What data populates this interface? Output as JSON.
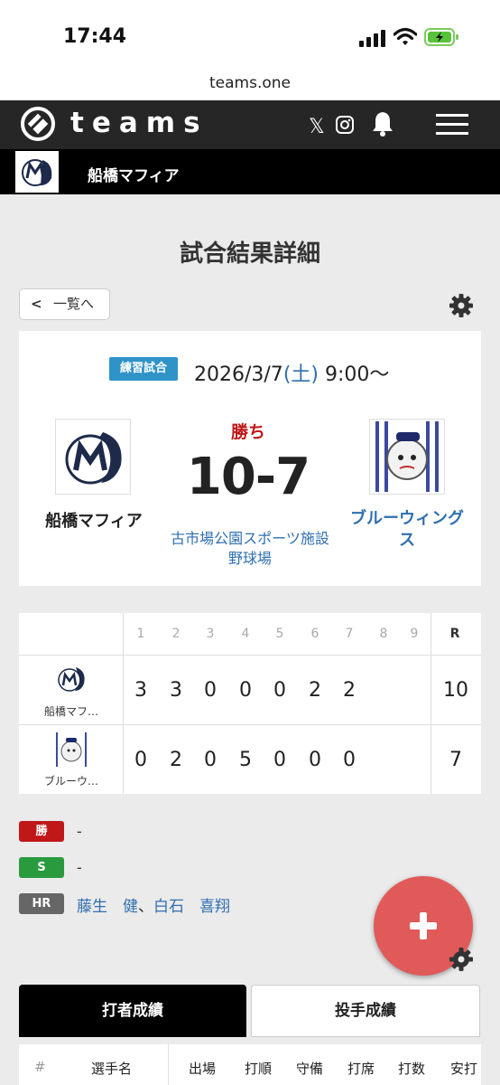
{
  "status": {
    "time": "17:44"
  },
  "browser": {
    "url": "teams.one"
  },
  "header": {
    "brand": "teams",
    "x_icon": "𝕏",
    "icons": [
      "logo-icon",
      "x-icon",
      "instagram-icon",
      "bell-icon",
      "menu-icon"
    ]
  },
  "teambar": {
    "team_name": "船橋マフィア"
  },
  "page": {
    "title": "試合結果詳細",
    "back_label": "一覧へ",
    "back_chevron": "<"
  },
  "game": {
    "type_badge": "練習試合",
    "date": "2026/3/7",
    "dow_open": "(",
    "dow": "土",
    "dow_close": ")",
    "start_time": " 9:00〜",
    "result": "勝ち",
    "score": "10-7",
    "home_team": "船橋マフィア",
    "away_team": "ブルーウィングス",
    "venue": "古市場公園スポーツ施設 野球場"
  },
  "scoreboard": {
    "innings": [
      "1",
      "2",
      "3",
      "4",
      "5",
      "6",
      "7",
      "8",
      "9"
    ],
    "runs_header": "R",
    "rows": [
      {
        "team": "船橋マフ…",
        "innings": [
          "3",
          "3",
          "0",
          "0",
          "0",
          "2",
          "2",
          "",
          ""
        ],
        "runs": "10"
      },
      {
        "team": "ブルーウ…",
        "innings": [
          "0",
          "2",
          "0",
          "5",
          "0",
          "0",
          "0",
          "",
          ""
        ],
        "runs": "7"
      }
    ]
  },
  "pitching": {
    "win_label": "勝",
    "win_value": "-",
    "save_label": "S",
    "save_value": "-",
    "hr_label": "HR",
    "home_runs": [
      "藤生　健",
      "白石　喜翔"
    ],
    "hr_separator": "、"
  },
  "tabs": {
    "batting": "打者成績",
    "pitching": "投手成績"
  },
  "table": {
    "headers": [
      "#",
      "選手名",
      "出場",
      "打順",
      "守備",
      "打席",
      "打数",
      "安打"
    ]
  },
  "colors": {
    "header_bg": "#262626",
    "badge_blue": "#2f93c7",
    "win_red": "#c01818",
    "save_green": "#2a9a3f",
    "link_blue": "#2f6fb0",
    "fab": "#e05a5a"
  }
}
